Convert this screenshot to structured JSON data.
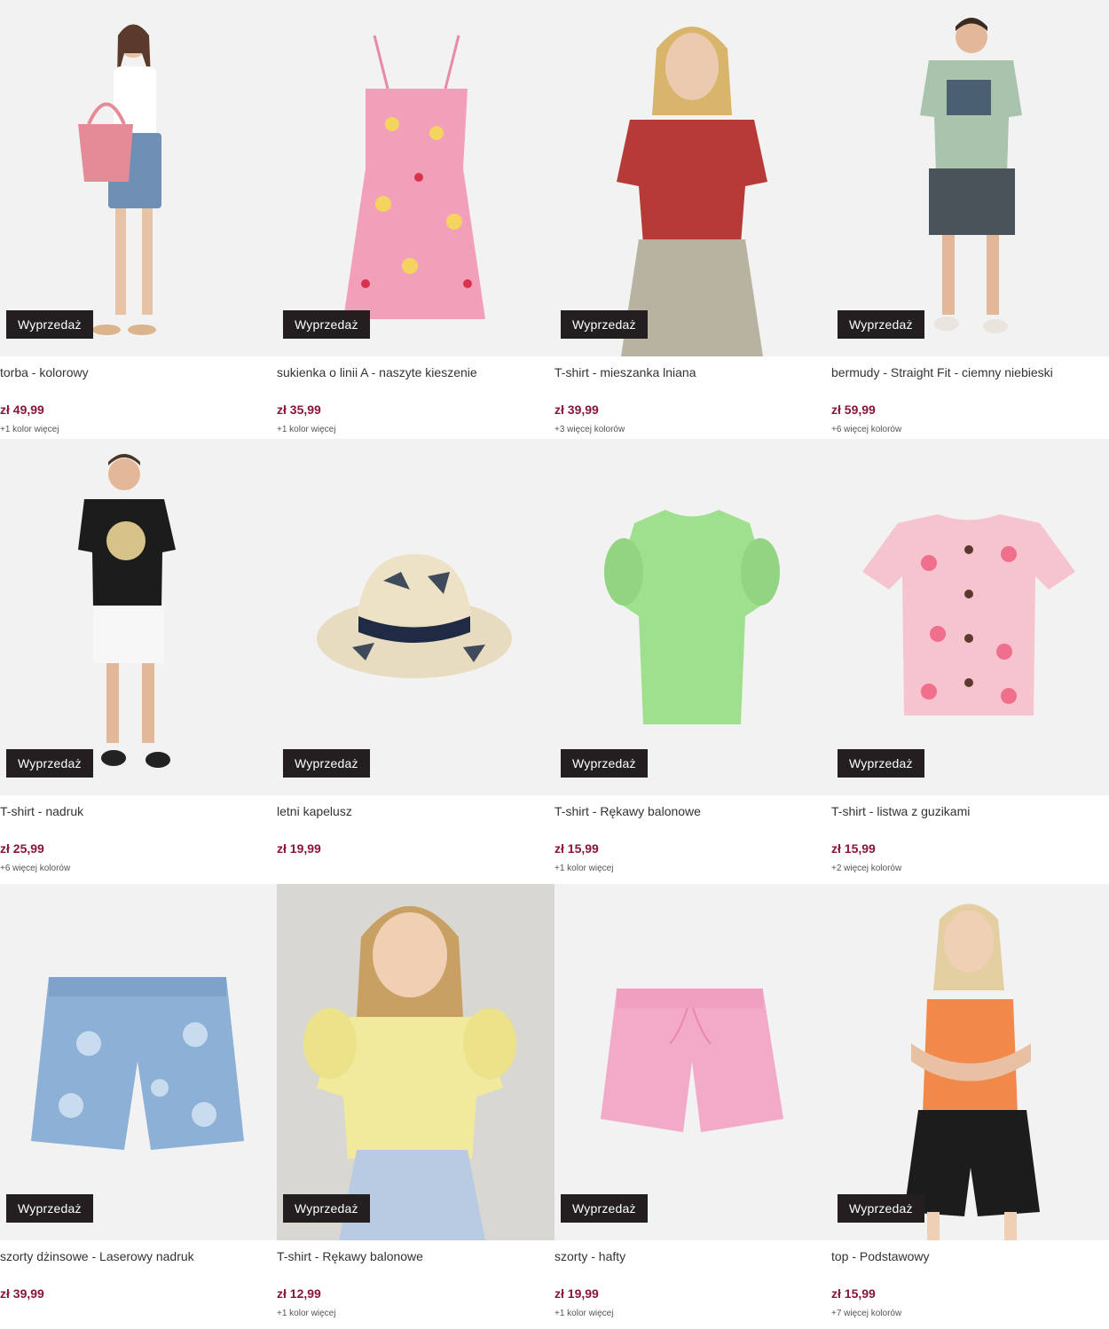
{
  "products": [
    {
      "badge": "Wyprzedaż",
      "title": "torba - kolorowy",
      "price": "zł 49,99",
      "colors": "+1 kolor więcej",
      "image": "woman-denim-shorts-pink-bag"
    },
    {
      "badge": "Wyprzedaż",
      "title": "sukienka o linii A - naszyte kieszenie",
      "price": "zł 35,99",
      "colors": "+1 kolor więcej",
      "image": "pink-lemon-print-dress"
    },
    {
      "badge": "Wyprzedaż",
      "title": "T-shirt - mieszanka lniana",
      "price": "zł 39,99",
      "colors": "+3 więcej kolorów",
      "image": "woman-red-tshirt"
    },
    {
      "badge": "Wyprzedaż",
      "title": "bermudy - Straight Fit - ciemny niebieski",
      "price": "zł 59,99",
      "colors": "+6 więcej kolorów",
      "image": "man-green-tshirt-grey-shorts"
    },
    {
      "badge": "Wyprzedaż",
      "title": "T-shirt - nadruk",
      "price": "zł 25,99",
      "colors": "+6 więcej kolorów",
      "image": "man-black-print-tshirt"
    },
    {
      "badge": "Wyprzedaż",
      "title": "letni kapelusz",
      "price": "zł 19,99",
      "colors": "",
      "image": "straw-hat-dinosaur"
    },
    {
      "badge": "Wyprzedaż",
      "title": "T-shirt - Rękawy balonowe",
      "price": "zł 15,99",
      "colors": "+1 kolor więcej",
      "image": "green-puff-sleeve-tshirt"
    },
    {
      "badge": "Wyprzedaż",
      "title": "T-shirt - listwa z guzikami",
      "price": "zł 15,99",
      "colors": "+2 więcej kolorów",
      "image": "pink-floral-button-tshirt"
    },
    {
      "badge": "Wyprzedaż",
      "title": "szorty dżinsowe - Laserowy nadruk",
      "price": "zł 39,99",
      "colors": "",
      "image": "denim-flower-shorts"
    },
    {
      "badge": "Wyprzedaż",
      "title": "T-shirt - Rękawy balonowe",
      "price": "zł 12,99",
      "colors": "+1 kolor więcej",
      "image": "girl-yellow-tshirt"
    },
    {
      "badge": "Wyprzedaż",
      "title": "szorty - hafty",
      "price": "zł 19,99",
      "colors": "+1 kolor więcej",
      "image": "pink-shorts"
    },
    {
      "badge": "Wyprzedaż",
      "title": "top - Podstawowy",
      "price": "zł 15,99",
      "colors": "+7 więcej kolorów",
      "image": "woman-orange-top"
    }
  ]
}
